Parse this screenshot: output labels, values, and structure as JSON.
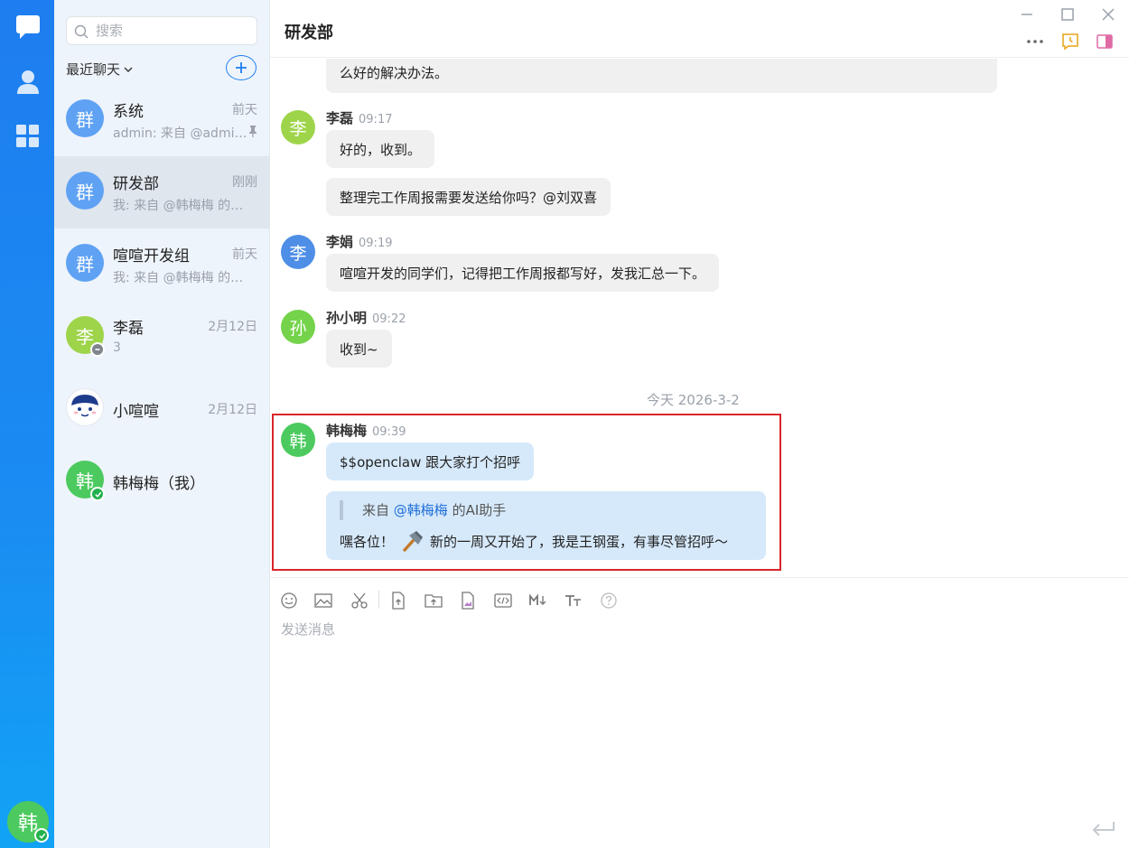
{
  "search": {
    "placeholder": "搜索"
  },
  "list": {
    "recent_label": "最近聊天",
    "conversations": [
      {
        "avatar": "群",
        "name": "系统",
        "time": "前天",
        "preview": "admin: 来自 @admin 的…"
      },
      {
        "avatar": "群",
        "name": "研发部",
        "time": "刚刚",
        "preview": "我: 来自 @韩梅梅 的…"
      },
      {
        "avatar": "群",
        "name": "喧喧开发组",
        "time": "前天",
        "preview": "我: 来自 @韩梅梅 的…"
      },
      {
        "avatar": "李",
        "name": "李磊",
        "time": "2月12日",
        "preview": "3"
      },
      {
        "avatar": "",
        "name": "小喧喧",
        "time": "2月12日",
        "preview": ""
      },
      {
        "avatar": "韩",
        "name": "韩梅梅（我）",
        "time": "",
        "preview": ""
      }
    ]
  },
  "rail": {
    "user_avatar": "韩"
  },
  "chat": {
    "title": "研发部",
    "messages": [
      {
        "text": "么好的解决办法。"
      },
      {
        "avatar": "李",
        "sender": "李磊",
        "time": "09:17",
        "text": "好的，收到。"
      },
      {
        "text": "整理完工作周报需要发送给你吗？@刘双喜"
      },
      {
        "avatar": "李",
        "sender": "李娟",
        "time": "09:19",
        "text": "喧喧开发的同学们，记得把工作周报都写好，发我汇总一下。"
      },
      {
        "avatar": "孙",
        "sender": "孙小明",
        "time": "09:22",
        "text": "收到~"
      },
      {
        "avatar": "韩",
        "sender": "韩梅梅",
        "time": "09:39",
        "text": "$$openclaw 跟大家打个招呼"
      }
    ],
    "date_separator": "今天 2026-3-2",
    "quote": {
      "from_prefix": "来自",
      "mention": "@韩梅梅",
      "from_suffix": "的AI助手",
      "body_before": "嘿各位！",
      "body_after": "新的一周又开始了，我是王钢蛋，有事尽管招呼～"
    }
  },
  "composer": {
    "placeholder": "发送消息"
  },
  "colors": {
    "accent": "#1e7df0",
    "highlight_border": "#d9262c",
    "online_green": "#22b14c"
  }
}
